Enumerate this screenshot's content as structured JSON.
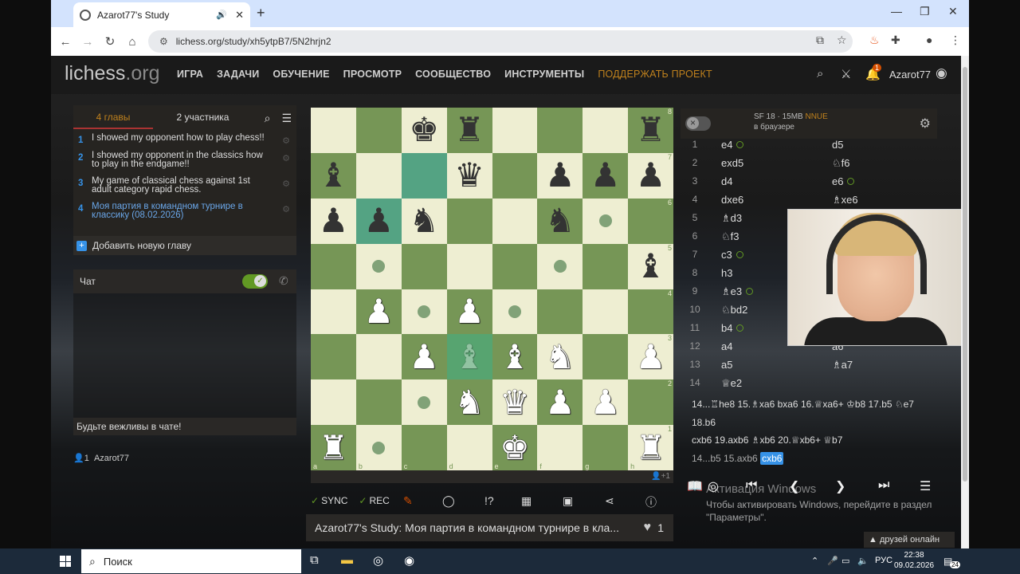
{
  "browser": {
    "tab_title": "Azarot77's Study",
    "url": "lichess.org/study/xh5ytpB7/5N2hrjn2"
  },
  "nav": {
    "logo_main": "lichess",
    "logo_suffix": ".org",
    "items": [
      "ИГРА",
      "ЗАДАЧИ",
      "ОБУЧЕНИЕ",
      "ПРОСМОТР",
      "СООБЩЕСТВО",
      "ИНСТРУМЕНТЫ"
    ],
    "donate": "ПОДДЕРЖАТЬ ПРОЕКТ",
    "notif_count": "1",
    "username": "Azarot77"
  },
  "chapters": {
    "tab_chapters": "4 главы",
    "tab_members": "2 участника",
    "list": [
      {
        "num": "1",
        "title": "I showed my opponent how to play chess!!"
      },
      {
        "num": "2",
        "title": "I showed my opponent in the classics how to play in the endgame!!"
      },
      {
        "num": "3",
        "title": "My game of classical chess against 1st adult category rapid chess."
      },
      {
        "num": "4",
        "title": "Моя партия в командном турнире в классику (08.02.2026)"
      }
    ],
    "add_label": "Добавить новую главу"
  },
  "chat": {
    "title": "Чат",
    "input_placeholder": "Будьте вежливы в чате!"
  },
  "members": {
    "count": "1",
    "name": "Azarot77"
  },
  "board": {
    "ranks": [
      "8",
      "7",
      "6",
      "5",
      "4",
      "3",
      "2",
      "1"
    ],
    "files": [
      "a",
      "b",
      "c",
      "d",
      "e",
      "f",
      "g",
      "h"
    ],
    "spectators": "+1"
  },
  "controls": {
    "sync": "SYNC",
    "rec": "REC"
  },
  "study_title": "Azarot77's Study: Моя партия в командном турнире в кла...",
  "likes": "1",
  "ceval": {
    "engine": "SF 18 · 15MB",
    "nnue": "NNUE",
    "location": "в браузере"
  },
  "moves": [
    {
      "n": "1",
      "w": "e4",
      "wc": true,
      "b": "d5",
      "bc": false
    },
    {
      "n": "2",
      "w": "exd5",
      "wc": false,
      "b": "♘f6",
      "bc": false
    },
    {
      "n": "3",
      "w": "d4",
      "wc": false,
      "b": "e6",
      "bc": true
    },
    {
      "n": "4",
      "w": "dxe6",
      "wc": false,
      "b": "♗xe6",
      "bc": false
    },
    {
      "n": "5",
      "w": "♗d3",
      "wc": false,
      "b": "",
      "bc": false
    },
    {
      "n": "6",
      "w": "♘f3",
      "wc": false,
      "b": "",
      "bc": false
    },
    {
      "n": "7",
      "w": "c3",
      "wc": true,
      "b": "",
      "bc": false
    },
    {
      "n": "8",
      "w": "h3",
      "wc": false,
      "b": "",
      "bc": false
    },
    {
      "n": "9",
      "w": "♗e3",
      "wc": true,
      "b": "",
      "bc": false
    },
    {
      "n": "10",
      "w": "♘bd2",
      "wc": false,
      "b": "",
      "bc": false
    },
    {
      "n": "11",
      "w": "b4",
      "wc": true,
      "b": "",
      "bc": false
    },
    {
      "n": "12",
      "w": "a4",
      "wc": false,
      "b": "a6",
      "bc": false
    },
    {
      "n": "13",
      "w": "a5",
      "wc": false,
      "b": "♗a7",
      "bc": false
    },
    {
      "n": "14",
      "w": "♕e2",
      "wc": false,
      "b": "",
      "bc": false
    }
  ],
  "variation": {
    "line1": "14...♖he8 15.♗xa6 bxa6 16.♕xa6+ ♔b8 17.b5 ♘e7 18.b6",
    "line2": "cxb6 19.axb6 ♗xb6 20.♕xb6+ ♕b7",
    "line3_pre": "14...b5 15.axb6",
    "line3_cur": "cxb6"
  },
  "windows": {
    "activation_title": "Активация Windows",
    "activation_text": "Чтобы активировать Windows, перейдите в раздел \"Параметры\".",
    "friends": "друзей онлайн",
    "search": "Поиск",
    "lang": "РУС",
    "time": "22:38",
    "date": "09.02.2026",
    "notif": "24"
  }
}
